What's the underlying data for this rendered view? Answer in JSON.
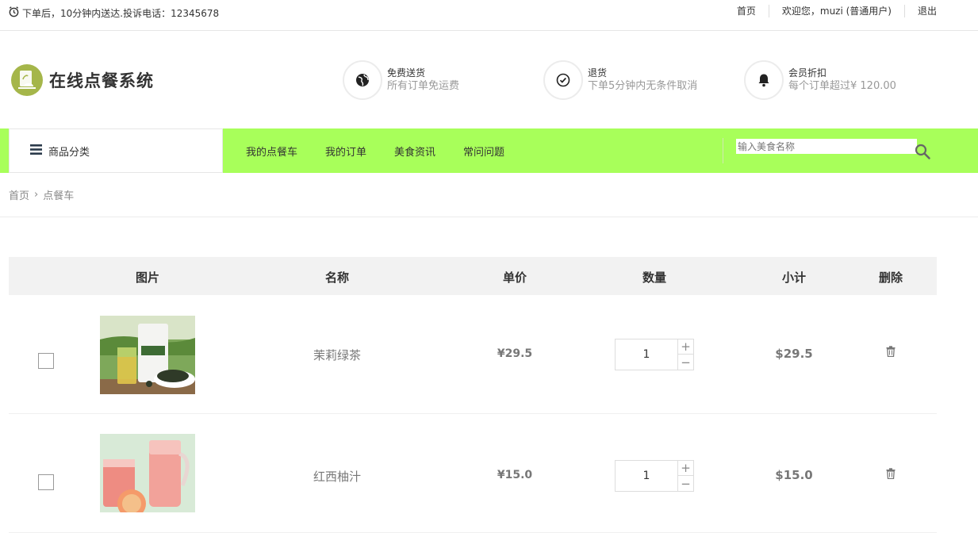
{
  "topbar": {
    "notice": "下单后，10分钟内送达.投诉电话：12345678",
    "links": [
      "首页",
      "欢迎您，muzi (普通用户)",
      "退出"
    ]
  },
  "header": {
    "logo_text": "在线点餐系统",
    "features": [
      {
        "icon": "globe-icon",
        "title": "免费送货",
        "desc": "所有订单免运费"
      },
      {
        "icon": "check-circle-icon",
        "title": "退货",
        "desc": "下单5分钟内无条件取消"
      },
      {
        "icon": "bell-icon",
        "title": "会员折扣",
        "desc": "每个订单超过¥ 120.00"
      }
    ]
  },
  "nav": {
    "category_label": "商品分类",
    "links": [
      "我的点餐车",
      "我的订单",
      "美食资讯",
      "常问问题"
    ],
    "search_placeholder": "输入美食名称"
  },
  "breadcrumb": {
    "home": "首页",
    "separator": "›",
    "current": "点餐车"
  },
  "cart": {
    "headers": [
      "图片",
      "名称",
      "单价",
      "数量",
      "小计",
      "删除"
    ],
    "items": [
      {
        "name": "茉莉绿茶",
        "price": "¥29.5",
        "quantity": "1",
        "subtotal": "$29.5"
      },
      {
        "name": "红西柚汁",
        "price": "¥15.0",
        "quantity": "1",
        "subtotal": "$15.0"
      }
    ]
  },
  "colors": {
    "nav_bg": "#a8ff5a",
    "logo_bg": "#a5b64a"
  }
}
